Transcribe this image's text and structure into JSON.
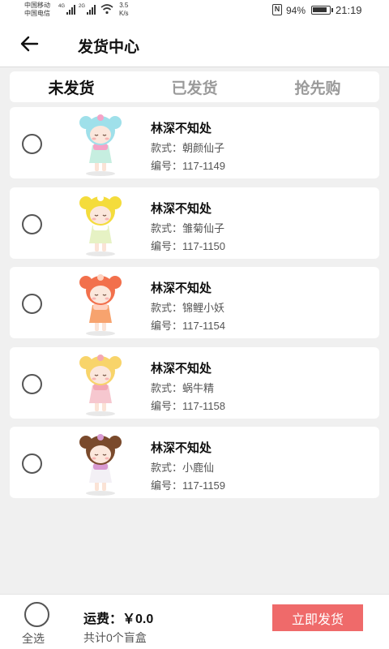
{
  "status_bar": {
    "carrier1": "中国移动",
    "carrier2": "中国电信",
    "net1": "4G",
    "net2": "2G",
    "speed_value": "3.5",
    "speed_unit": "K/s",
    "nfc": "N",
    "battery": "94%",
    "time": "21:19"
  },
  "header": {
    "title": "发货中心"
  },
  "tabs": [
    {
      "label": "未发货",
      "active": true
    },
    {
      "label": "已发货",
      "active": false
    },
    {
      "label": "抢先购",
      "active": false
    }
  ],
  "items": [
    {
      "name": "林深不知处",
      "style": "款式：朝颜仙子",
      "code": "编号：117-1149",
      "hair": "#9fe0ea",
      "accent": "#f5a3c7",
      "dress": "#c6eee0"
    },
    {
      "name": "林深不知处",
      "style": "款式：雏菊仙子",
      "code": "编号：117-1150",
      "hair": "#f4dc3c",
      "accent": "#ffffff",
      "dress": "#e6f2c4"
    },
    {
      "name": "林深不知处",
      "style": "款式：锦鲤小妖",
      "code": "编号：117-1154",
      "hair": "#f2704c",
      "accent": "#ffd2c0",
      "dress": "#f7a36e"
    },
    {
      "name": "林深不知处",
      "style": "款式：蜗牛精",
      "code": "编号：117-1158",
      "hair": "#f8d46a",
      "accent": "#f3a7b3",
      "dress": "#f6c7cf"
    },
    {
      "name": "林深不知处",
      "style": "款式：小鹿仙",
      "code": "编号：117-1159",
      "hair": "#7a4a2c",
      "accent": "#d89ad2",
      "dress": "#f3f0f5"
    }
  ],
  "footer": {
    "select_all": "全选",
    "fee_label": "运费：￥0.0",
    "total": "共计0个盲盒",
    "ship_button": "立即发货"
  },
  "colors": {
    "accent": "#ef6a6a",
    "background": "#f0f0f0"
  }
}
